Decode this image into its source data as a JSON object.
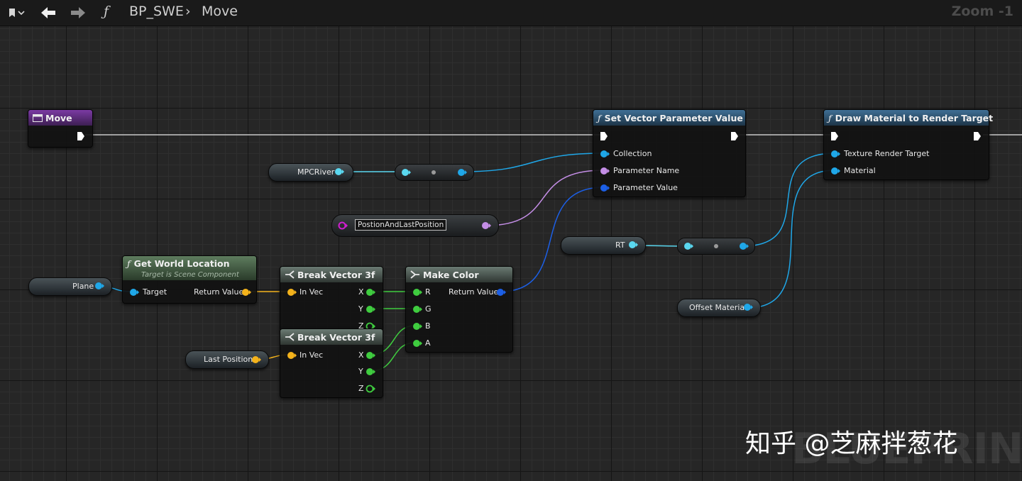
{
  "toolbar": {
    "breadcrumb_root": "BP_SWE",
    "breadcrumb_sep": "›",
    "breadcrumb_leaf": "Move",
    "zoom": "Zoom -1",
    "function_icon": "ƒ"
  },
  "nodes": {
    "event": {
      "title": "Move"
    },
    "set_vector": {
      "title": "Set Vector Parameter Value",
      "pins": [
        "Collection",
        "Parameter Name",
        "Parameter Value"
      ]
    },
    "draw_material": {
      "title": "Draw Material to Render Target",
      "pins": [
        "Texture Render Target",
        "Material"
      ]
    },
    "get_world_location": {
      "title": "Get World Location",
      "subtitle": "Target is Scene Component",
      "in_pin": "Target",
      "out_pin": "Return Value"
    },
    "break_vector_1": {
      "title": "Break Vector 3f",
      "in_pin": "In Vec",
      "out_pins": [
        "X",
        "Y",
        "Z"
      ]
    },
    "break_vector_2": {
      "title": "Break Vector 3f",
      "in_pin": "In Vec",
      "out_pins": [
        "X",
        "Y",
        "Z"
      ]
    },
    "make_color": {
      "title": "Make Color",
      "in_pins": [
        "R",
        "G",
        "B",
        "A"
      ],
      "out_pin": "Return Value"
    }
  },
  "variables": {
    "mpc_river": "MPCRiver",
    "param_name_value": "PostionAndLastPosition",
    "rt": "RT",
    "plane": "Plane",
    "last_position": "Last Position",
    "offset_material": "Offset Material"
  },
  "watermark": {
    "text": "知乎 @芝麻拌葱花",
    "background_label": "BLUEPRINT"
  },
  "colors": {
    "exec": "#ffffff",
    "object": "#1fa7e8",
    "class": "#5ad8f0",
    "name": "#c48ee6",
    "struct": "#f3b21b",
    "float": "#3fcc3f",
    "color": "#1c5fe6",
    "name_magenta": "#d01ed0"
  },
  "icons": [
    "bookmark-icon",
    "chevron-down-icon",
    "back-arrow-icon",
    "forward-arrow-icon",
    "function-icon",
    "event-icon",
    "macro-icon"
  ]
}
